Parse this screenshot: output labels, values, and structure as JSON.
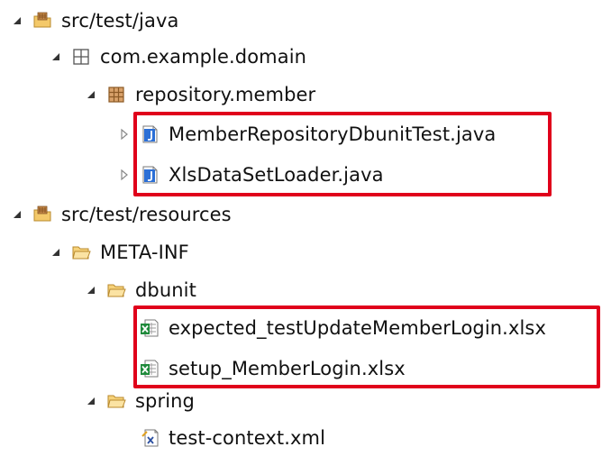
{
  "tree": {
    "items": [
      {
        "label": "src/test/java"
      },
      {
        "label": "com.example.domain"
      },
      {
        "label": "repository.member"
      },
      {
        "label": "MemberRepositoryDbunitTest.java"
      },
      {
        "label": "XlsDataSetLoader.java"
      },
      {
        "label": "src/test/resources"
      },
      {
        "label": "META-INF"
      },
      {
        "label": "dbunit"
      },
      {
        "label": "expected_testUpdateMemberLogin.xlsx"
      },
      {
        "label": "setup_MemberLogin.xlsx"
      },
      {
        "label": "spring"
      },
      {
        "label": "test-context.xml"
      }
    ]
  },
  "icons": {
    "source_folder": "source-folder-icon",
    "package": "package-icon",
    "java_file": "java-file-icon",
    "folder": "folder-icon",
    "excel_file": "excel-file-icon",
    "xml_file": "xml-file-icon",
    "expanded_twisty": "expanded-triangle-icon",
    "collapsed_twisty": "collapsed-triangle-icon"
  },
  "colors": {
    "highlight": "#e0001b",
    "folder": "#f4c96a",
    "java": "#2b6fd6",
    "excel": "#1f8a3b"
  }
}
